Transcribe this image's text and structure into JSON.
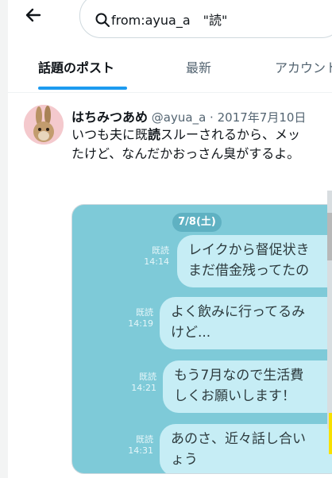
{
  "search": {
    "query": "from:ayua_a　\"読\""
  },
  "tabs": [
    {
      "label": "話題のポスト",
      "active": true
    },
    {
      "label": "最新",
      "active": false
    },
    {
      "label": "アカウント",
      "active": false
    }
  ],
  "post": {
    "display_name": "はちみつあめ",
    "handle": "@ayua_a",
    "separator": "·",
    "date": "2017年7月10日",
    "line1_before": "いつも夫に既",
    "line1_bold": "読",
    "line1_after": "スルーされるから、メッ",
    "line2": "たけど、なんだかおっさん臭がするよ。",
    "image": {
      "date_chip": "7/8(土)",
      "messages": [
        {
          "status": "既読",
          "time": "14:14",
          "text": "レイクから督促状き\nまだ借金残ってたの"
        },
        {
          "status": "既読",
          "time": "14:19",
          "text": "よく飲みに行ってるみ\nけど..."
        },
        {
          "status": "既読",
          "time": "14:21",
          "text": "もう7月なので生活費\nしくお願いします！"
        },
        {
          "status": "既読",
          "time": "14:31",
          "text": "あのさ、近々話し合い\nょう"
        }
      ]
    }
  },
  "colors": {
    "accent": "#1d9bf0",
    "chat_background": "#7ecad8",
    "bubble": "#c6edf5"
  }
}
